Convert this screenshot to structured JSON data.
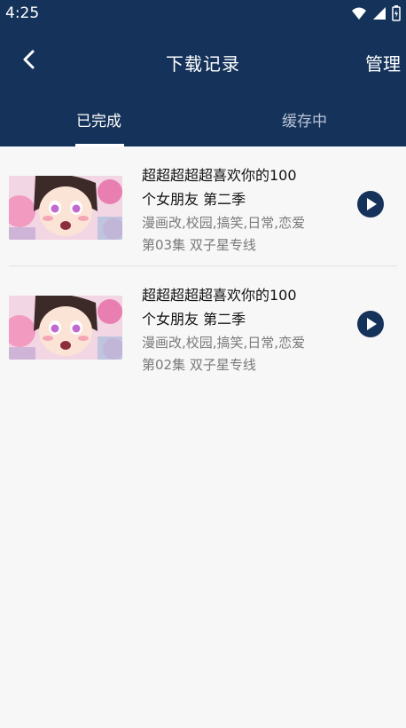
{
  "status_bar": {
    "time": "4:25",
    "icons": [
      "wifi-icon",
      "signal-icon",
      "battery-icon"
    ]
  },
  "header": {
    "title": "下载记录",
    "manage_label": "管理"
  },
  "tabs": [
    {
      "label": "已完成",
      "active": true
    },
    {
      "label": "缓存中",
      "active": false
    }
  ],
  "downloads": [
    {
      "title_line1": "超超超超超喜欢你的100",
      "title_line2": "个女朋友 第二季",
      "tags": "漫画改,校园,搞笑,日常,恋爱",
      "episode": "第03集 双子星专线"
    },
    {
      "title_line1": "超超超超超喜欢你的100",
      "title_line2": "个女朋友 第二季",
      "tags": "漫画改,校园,搞笑,日常,恋爱",
      "episode": "第02集 双子星专线"
    }
  ],
  "colors": {
    "header_bg": "#15335a",
    "page_bg": "#f7f7f7",
    "accent": "#15335a"
  }
}
